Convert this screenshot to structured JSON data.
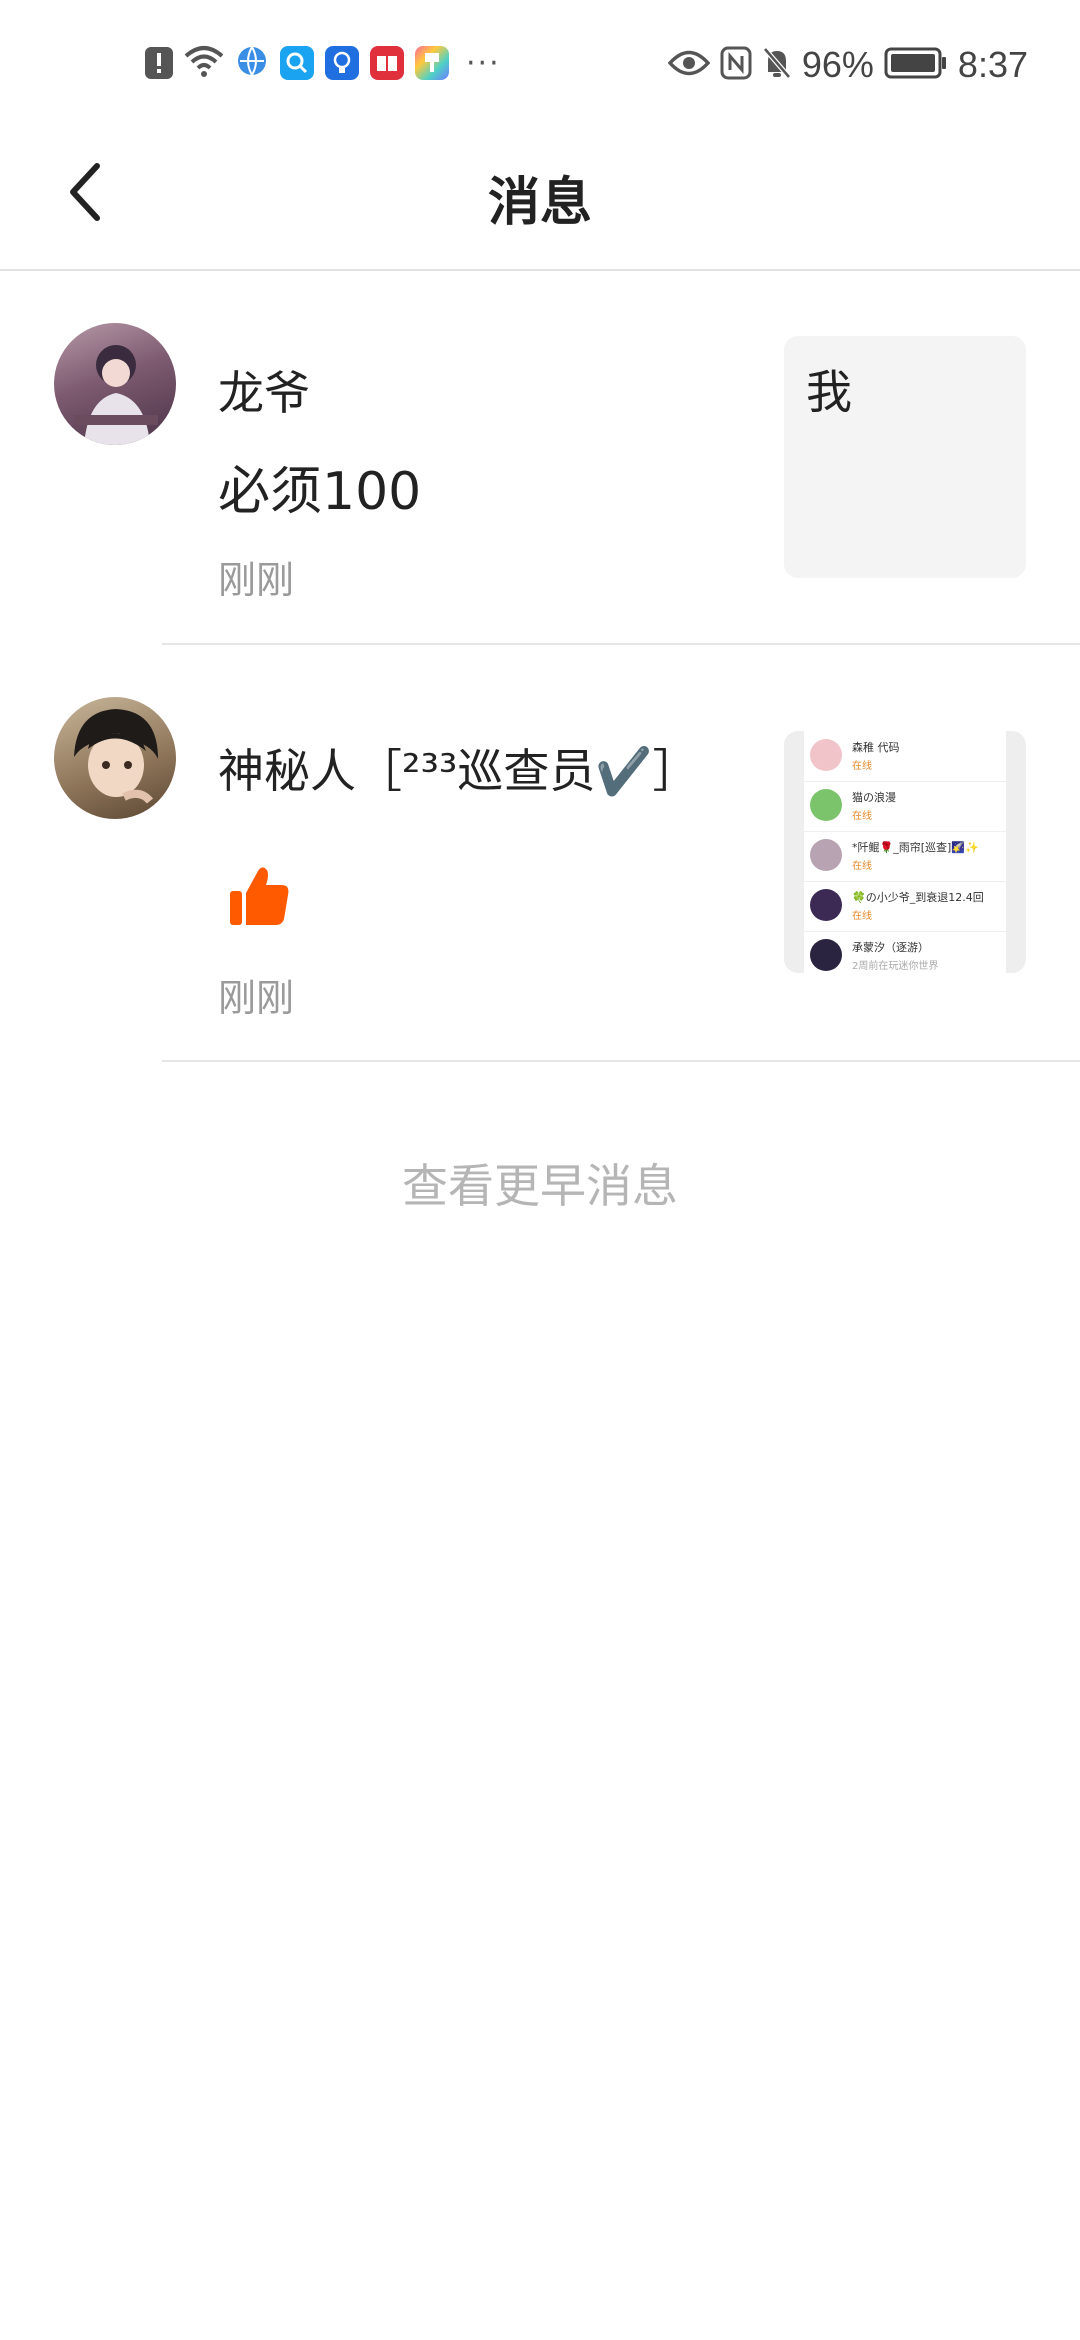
{
  "status_bar": {
    "left_icons": [
      "alert-icon",
      "wifi-icon",
      "browser-icon",
      "search-app-icon",
      "bulb-app-icon",
      "book-app-icon",
      "paint-app-icon"
    ],
    "more": "···",
    "battery": "96%",
    "time": "8:37",
    "right_icons": [
      "eye-icon",
      "nfc-icon",
      "bell-off-icon",
      "battery-icon"
    ]
  },
  "header": {
    "title": "消息"
  },
  "messages": [
    {
      "name": "龙爷",
      "content": "必须100",
      "time": "刚刚",
      "thumb_text": "我"
    },
    {
      "name": "神秘人［²³³巡查员✔️］",
      "content_icon": "thumbs-up-icon",
      "time": "刚刚",
      "thumb_rows": [
        {
          "name": "森稚 代码",
          "status": "在线"
        },
        {
          "name": "猫の浪漫",
          "status": "在线"
        },
        {
          "name": "*阡鲲🌹_雨帘[巡查]🌠✨",
          "status": "在线"
        },
        {
          "name": "🍀の小少爷_到衰退12.4回",
          "status": "在线"
        },
        {
          "name": "承蒙汐（逐游）",
          "status": "2周前在玩迷你世界"
        }
      ]
    }
  ],
  "more_label": "查看更早消息",
  "colors": {
    "accent": "#ff5a00",
    "muted": "#9a9a9a"
  }
}
